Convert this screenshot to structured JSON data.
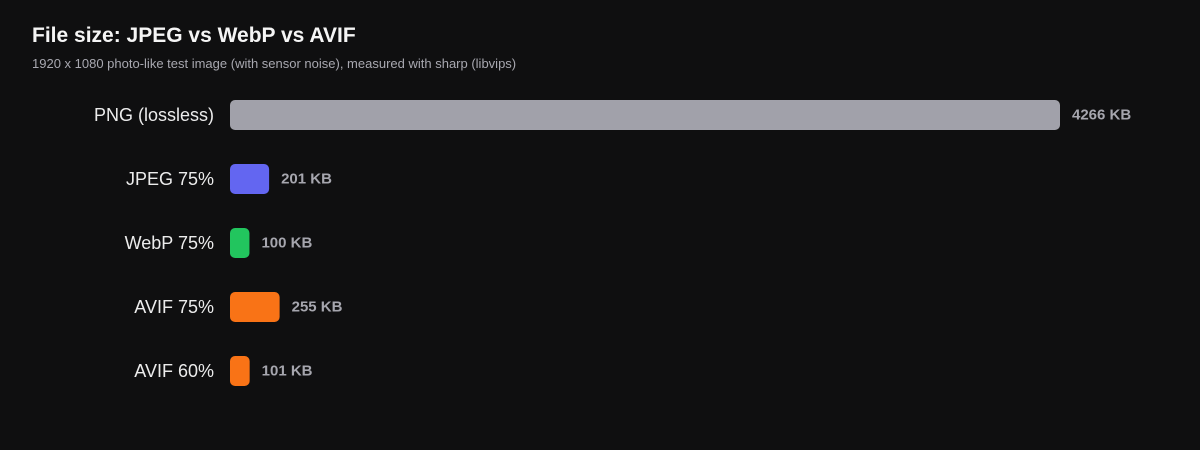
{
  "chart_data": {
    "type": "bar",
    "orientation": "horizontal",
    "title": "File size: JPEG vs WebP vs AVIF",
    "subtitle": "1920 x 1080 photo-like test image (with sensor noise), measured with sharp (libvips)",
    "categories": [
      "PNG (lossless)",
      "JPEG 75%",
      "WebP 75%",
      "AVIF 75%",
      "AVIF 60%"
    ],
    "values": [
      4266,
      201,
      100,
      255,
      101
    ],
    "value_labels": [
      "4266 KB",
      "201 KB",
      "100 KB",
      "255 KB",
      "101 KB"
    ],
    "unit": "KB",
    "xlim": [
      0,
      4266
    ],
    "colors": [
      "#a1a1aa",
      "#6366f1",
      "#22c55e",
      "#f97316",
      "#f97316"
    ],
    "grid": false,
    "legend": "none",
    "xlabel": "",
    "ylabel": ""
  }
}
